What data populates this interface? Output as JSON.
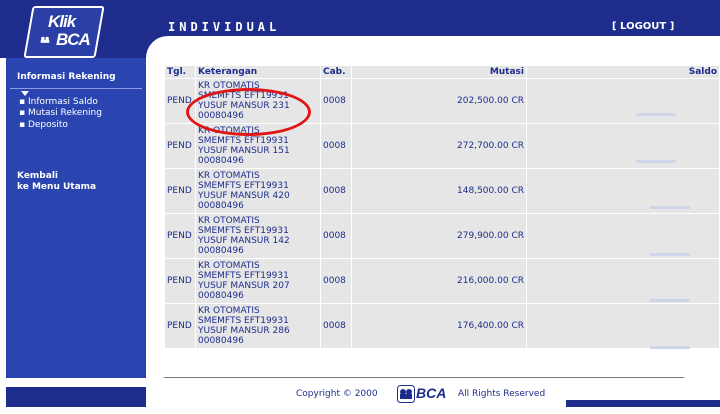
{
  "header": {
    "logo_line1": "Klik",
    "logo_line2": "BCA",
    "title": "INDIVIDUAL",
    "logout_label": "[ LOGOUT ]"
  },
  "sidebar": {
    "section_title": "Informasi Rekening",
    "items": [
      {
        "label": "Informasi Saldo"
      },
      {
        "label": "Mutasi Rekening"
      },
      {
        "label": "Deposito"
      }
    ],
    "back_line1": "Kembali",
    "back_line2": "ke Menu Utama"
  },
  "table": {
    "headers": {
      "date": "Tgl.",
      "desc": "Keterangan",
      "branch": "Cab.",
      "amount": "Mutasi",
      "balance": "Saldo"
    },
    "rows": [
      {
        "date": "PEND",
        "desc": [
          "KR OTOMATIS",
          "SMEMFTS EFT19931",
          "YUSUF MANSUR 231",
          "00080496"
        ],
        "branch": "0008",
        "amount": "202,500.00",
        "type": "CR",
        "balance": ""
      },
      {
        "date": "PEND",
        "desc": [
          "KR OTOMATIS",
          "SMEMFTS EFT19931",
          "YUSUF MANSUR 151",
          "00080496"
        ],
        "branch": "0008",
        "amount": "272,700.00",
        "type": "CR",
        "balance": ""
      },
      {
        "date": "PEND",
        "desc": [
          "KR OTOMATIS",
          "SMEMFTS EFT19931",
          "YUSUF MANSUR 420",
          "00080496"
        ],
        "branch": "0008",
        "amount": "148,500.00",
        "type": "CR",
        "balance": ""
      },
      {
        "date": "PEND",
        "desc": [
          "KR OTOMATIS",
          "SMEMFTS EFT19931",
          "YUSUF MANSUR 142",
          "00080496"
        ],
        "branch": "0008",
        "amount": "279,900.00",
        "type": "CR",
        "balance": ""
      },
      {
        "date": "PEND",
        "desc": [
          "KR OTOMATIS",
          "SMEMFTS EFT19931",
          "YUSUF MANSUR 207",
          "00080496"
        ],
        "branch": "0008",
        "amount": "216,000.00",
        "type": "CR",
        "balance": ""
      },
      {
        "date": "PEND",
        "desc": [
          "KR OTOMATIS",
          "SMEMFTS EFT19931",
          "YUSUF MANSUR 286",
          "00080496"
        ],
        "branch": "0008",
        "amount": "176,400.00",
        "type": "CR",
        "balance": ""
      }
    ]
  },
  "footer": {
    "copyright": "Copyright © 2000",
    "logo_text": "BCA",
    "reserved": "All Rights Reserved"
  },
  "colors": {
    "brand": "#1e2d8c",
    "sidebar": "#2b45b0",
    "row_bg": "#e6e6e6",
    "annotation": "#e01515"
  }
}
